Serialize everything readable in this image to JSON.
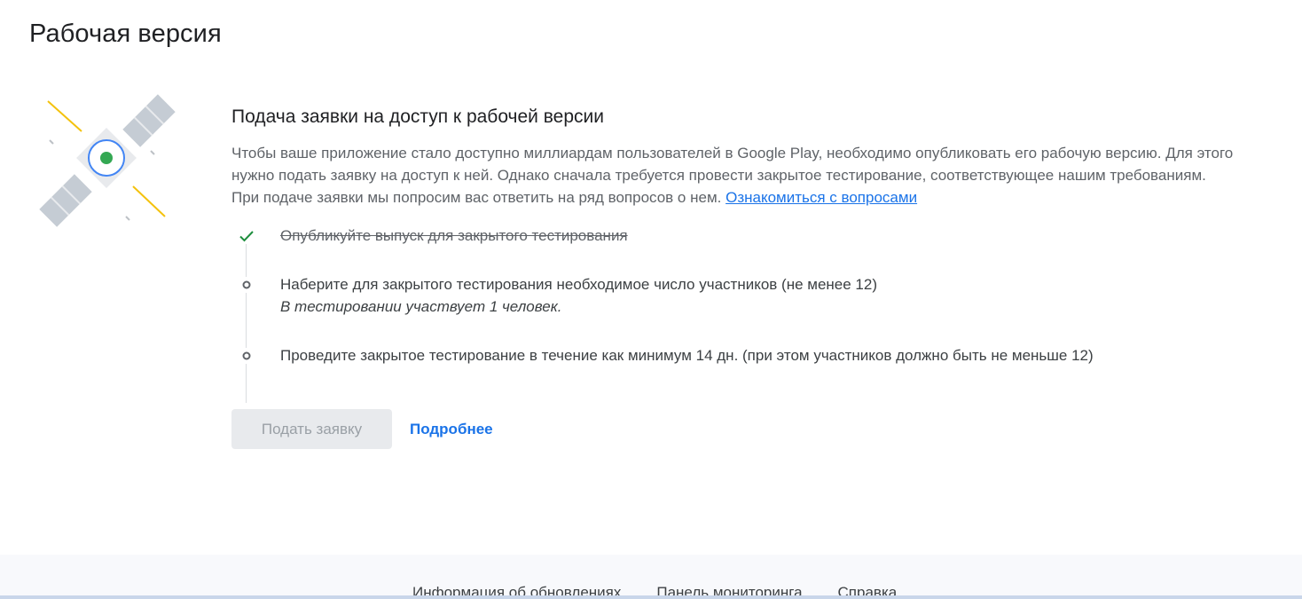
{
  "page": {
    "title": "Рабочая версия"
  },
  "production_access": {
    "heading": "Подача заявки на доступ к рабочей версии",
    "description": "Чтобы ваше приложение стало доступно миллиардам пользователей в Google Play, необходимо опубликовать его рабочую версию. Для этого нужно подать заявку на доступ к ней. Однако сначала требуется провести закрытое тестирование, соответствующее нашим требованиям. При подаче заявки мы попросим вас ответить на ряд вопросов о нем.",
    "questions_link": "Ознакомиться с вопросами",
    "steps": [
      {
        "label": "Опубликуйте выпуск для закрытого тестирования",
        "status": "done",
        "icon": "check-icon"
      },
      {
        "label": "Наберите для закрытого тестирования необходимое число участников (не менее 12)",
        "sublabel": "В тестировании участвует 1 человек.",
        "status": "pending",
        "icon": "circle-icon"
      },
      {
        "label": "Проведите закрытое тестирование в течение как минимум 14 дн. (при этом участников должно быть не меньше 12)",
        "status": "pending",
        "icon": "circle-icon"
      }
    ],
    "submit_button": "Подать заявку",
    "more_button": "Подробнее"
  },
  "footer": {
    "links": [
      "Информация об обновлениях",
      "Панель мониторинга",
      "Справка"
    ]
  },
  "colors": {
    "accent": "#1a73e8",
    "success": "#1e8e3e",
    "disabled_bg": "#e8eaed",
    "disabled_text": "#9aa0a6"
  }
}
